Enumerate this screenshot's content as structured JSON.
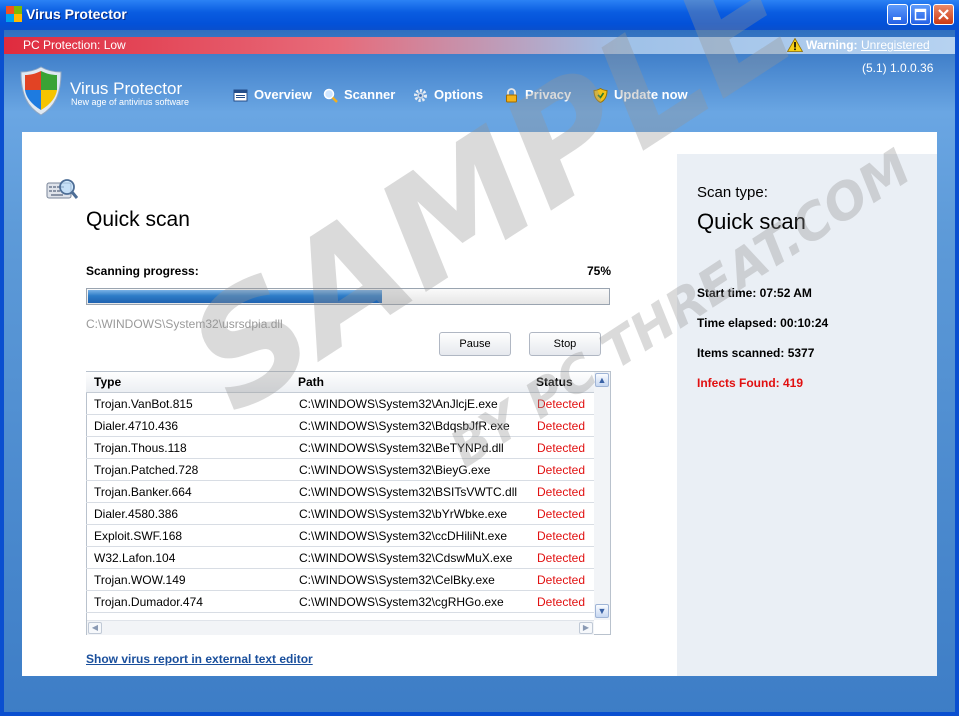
{
  "window": {
    "title": "Virus Protector"
  },
  "status": {
    "protection": "PC Protection: Low",
    "warning_label": "Warning:",
    "warning_link": "Unregistered",
    "version": "(5.1) 1.0.0.36"
  },
  "brand": {
    "name": "Virus Protector",
    "tagline": "New age of antivirus software"
  },
  "nav": [
    {
      "label": "Overview",
      "icon": "overview-icon"
    },
    {
      "label": "Scanner",
      "icon": "magnifier-icon"
    },
    {
      "label": "Options",
      "icon": "gear-icon"
    },
    {
      "label": "Privacy",
      "icon": "lock-icon"
    },
    {
      "label": "Update now",
      "icon": "shield-update-icon"
    }
  ],
  "scan": {
    "title": "Quick scan",
    "progress_label": "Scanning progress:",
    "progress_text": "75%",
    "progress_value": 0.75,
    "current_file": "C:\\WINDOWS\\System32\\usrsdpia.dll",
    "pause_label": "Pause",
    "stop_label": "Stop"
  },
  "table": {
    "columns": [
      "Type",
      "Path",
      "Status"
    ],
    "rows": [
      [
        "Trojan.VanBot.815",
        "C:\\WINDOWS\\System32\\AnJlcjE.exe",
        "Detected"
      ],
      [
        "Dialer.4710.436",
        "C:\\WINDOWS\\System32\\BdqsbJfR.exe",
        "Detected"
      ],
      [
        "Trojan.Thous.118",
        "C:\\WINDOWS\\System32\\BeTYNPd.dll",
        "Detected"
      ],
      [
        "Trojan.Patched.728",
        "C:\\WINDOWS\\System32\\BieyG.exe",
        "Detected"
      ],
      [
        "Trojan.Banker.664",
        "C:\\WINDOWS\\System32\\BSITsVWTC.dll",
        "Detected"
      ],
      [
        "Dialer.4580.386",
        "C:\\WINDOWS\\System32\\bYrWbke.exe",
        "Detected"
      ],
      [
        "Exploit.SWF.168",
        "C:\\WINDOWS\\System32\\ccDHiliNt.exe",
        "Detected"
      ],
      [
        "W32.Lafon.104",
        "C:\\WINDOWS\\System32\\CdswMuX.exe",
        "Detected"
      ],
      [
        "Trojan.WOW.149",
        "C:\\WINDOWS\\System32\\CelBky.exe",
        "Detected"
      ],
      [
        "Trojan.Dumador.474",
        "C:\\WINDOWS\\System32\\cgRHGo.exe",
        "Detected"
      ]
    ]
  },
  "report_link": "Show virus report in external text editor",
  "summary": {
    "scan_type_label": "Scan type:",
    "scan_type": "Quick scan",
    "start_time": "Start time: 07:52 AM",
    "elapsed": "Time elapsed: 00:10:24",
    "items": "Items scanned: 5377",
    "infects": "Infects Found: 419"
  },
  "watermark": {
    "line1": "SAMPLE",
    "line2": "BY PC THREAT.COM"
  }
}
